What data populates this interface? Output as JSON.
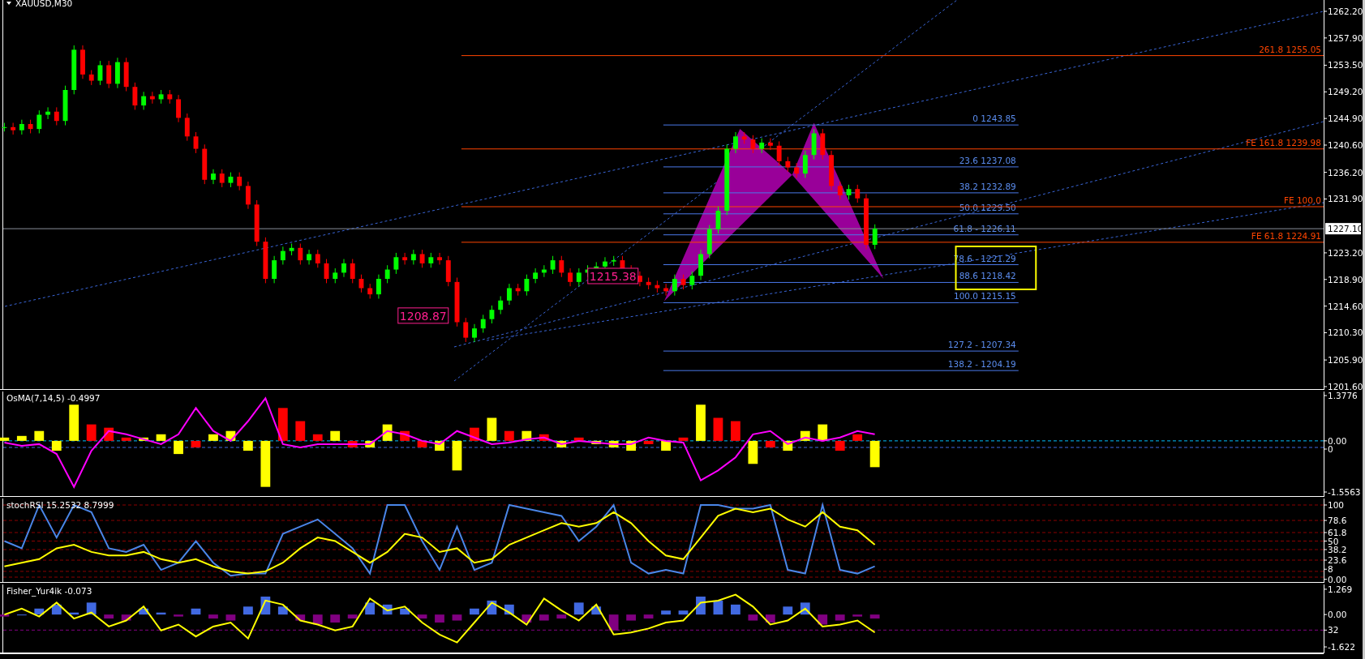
{
  "chart": {
    "symbol_title": "XAUUSD,M30",
    "price_axis": [
      "1262.20",
      "1257.90",
      "1253.50",
      "1249.20",
      "1244.90",
      "1240.60",
      "1236.20",
      "1231.90",
      "1223.20",
      "1218.90",
      "1214.60",
      "1210.30",
      "1205.90",
      "1201.60"
    ],
    "current_price": "1227.10",
    "fibo_labels": [
      "0 1243.85",
      "23.6 1237.08",
      "38.2 1232.89",
      "50.0 1229.50",
      "61.8 - 1226.11",
      "78.6 - 1221.29",
      "88.6 1218.42",
      "100.0 1215.15",
      "127.2 - 1207.34",
      "138.2 - 1204.19"
    ],
    "expansion_labels": [
      "261.8 1255.05",
      "FE 161.8 1239.98",
      "FE 100.0",
      "FE 61.8 1224.91"
    ],
    "price_tags": [
      "1208.87",
      "1215.38"
    ]
  },
  "indicators": [
    {
      "title": "OsMA(7,14,5) -0.4997",
      "axis_labels": [
        "1.3776",
        "0.00",
        "0",
        "-1.5563"
      ]
    },
    {
      "title": "stochRSI 15.2532 8.7999",
      "axis_labels": [
        "100",
        "78.6",
        "61.8",
        "50",
        "38.2",
        "23.6",
        "8",
        "0.00"
      ]
    },
    {
      "title": "Fisher_Yur4ik -0.073",
      "axis_labels": [
        "1.269",
        "0.00",
        "32",
        "-1.622"
      ]
    }
  ]
}
